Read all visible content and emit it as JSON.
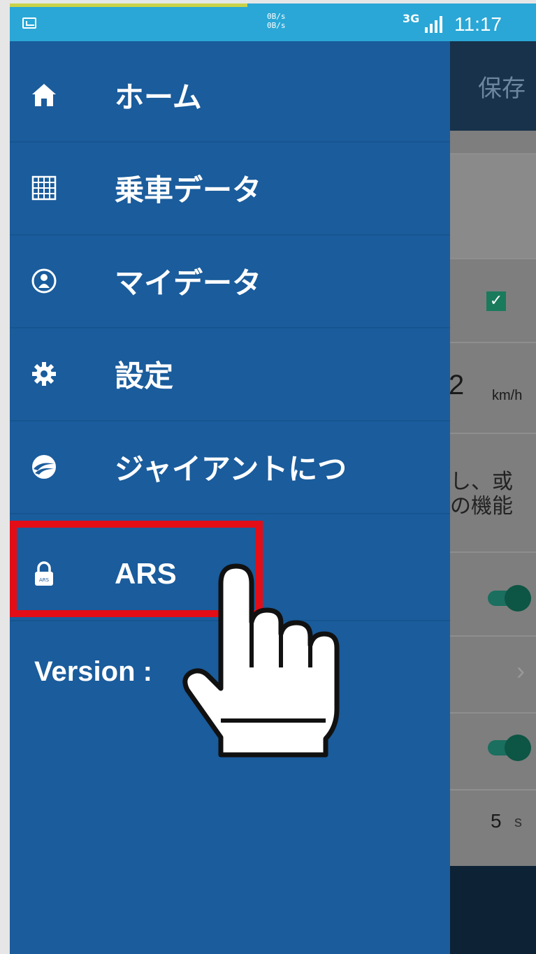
{
  "status_bar": {
    "net_up": "0B/s",
    "net_down": "0B/s",
    "network": "3G",
    "time": "11:17",
    "icons": [
      "image-notification-icon",
      "signal-icon"
    ]
  },
  "background": {
    "save_label": "保存",
    "speed_value": "2",
    "speed_unit": "km/h",
    "text_line1": "し、或",
    "text_line2": "の機能",
    "seconds_value": "5",
    "seconds_unit": "s"
  },
  "menu": {
    "items": [
      {
        "label": "ホーム",
        "icon": "home-icon"
      },
      {
        "label": "乗車データ",
        "icon": "grid-icon"
      },
      {
        "label": "マイデータ",
        "icon": "user-icon"
      },
      {
        "label": "設定",
        "icon": "gear-icon"
      },
      {
        "label": "ジャイアントにつ",
        "icon": "giant-logo-icon"
      },
      {
        "label": "ARS",
        "icon": "lock-icon"
      }
    ],
    "version": "Version :",
    "highlight_color": "#e30d17",
    "drawer_color": "#1a5c9c"
  }
}
